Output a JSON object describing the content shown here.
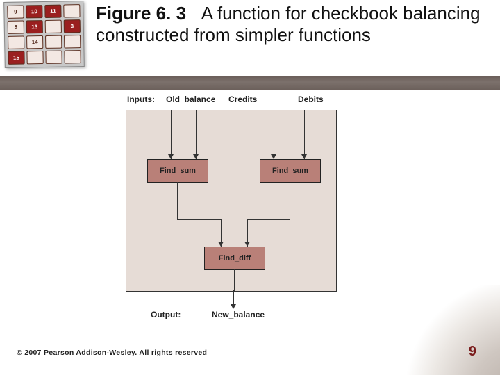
{
  "figure": {
    "label": "Figure 6. 3",
    "caption": "A function for checkbook balancing constructed from simpler functions"
  },
  "diagram": {
    "inputs_label": "Inputs:",
    "inputs": [
      "Old_balance",
      "Credits",
      "Debits"
    ],
    "processes": {
      "sum1": "Find_sum",
      "sum2": "Find_sum",
      "diff": "Find_diff"
    },
    "output_label": "Output:",
    "output": "New_balance"
  },
  "copyright": "© 2007 Pearson Addison-Wesley. All rights reserved",
  "page_number": "9",
  "corner_tiles": [
    "9",
    "10",
    "11",
    "",
    "5",
    "13",
    "",
    "3",
    "",
    "14",
    "",
    "",
    "15",
    "",
    "",
    ""
  ]
}
